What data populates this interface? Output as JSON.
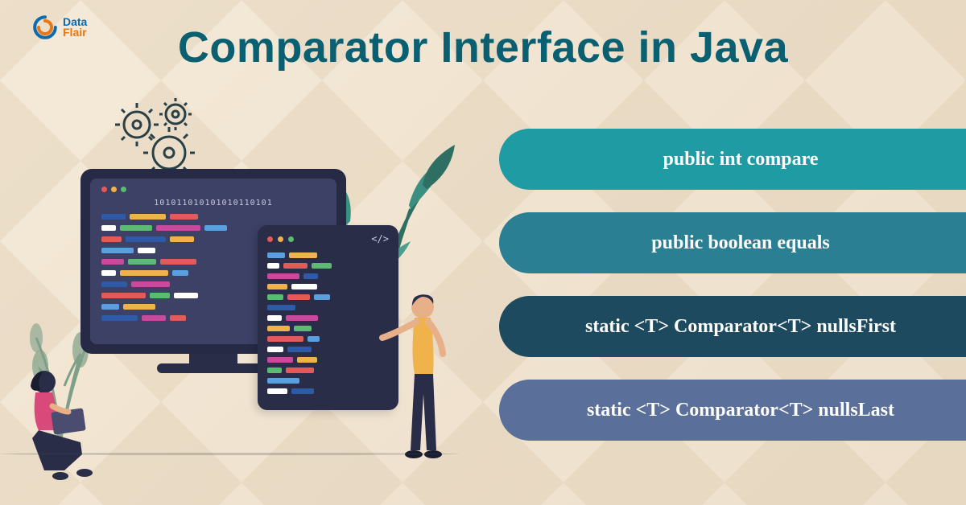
{
  "logo": {
    "name": "DataFlair",
    "line1": "Data",
    "line2": "Flair"
  },
  "title": "Comparator Interface in Java",
  "binary_string": "101011010101010110101",
  "code_tag": "</>",
  "pills": [
    {
      "label": "public int compare",
      "color": "#1f9ba3"
    },
    {
      "label": "public boolean equals",
      "color": "#2b7f93"
    },
    {
      "label": "static <T> Comparator<T> nullsFirst",
      "color": "#1e4a5f"
    },
    {
      "label": "static <T> Comparator<T> nullsLast",
      "color": "#5a6f99"
    }
  ],
  "people": {
    "sitting": "person-with-laptop",
    "standing": "person-pointing"
  },
  "colors": {
    "title": "#0a6070",
    "background": "#f5ead8",
    "code_bars": [
      "#e35a5a",
      "#f0b24a",
      "#5cbb72",
      "#5aa0e0",
      "#c94a9c",
      "#ffffff",
      "#2f5aa8"
    ]
  }
}
